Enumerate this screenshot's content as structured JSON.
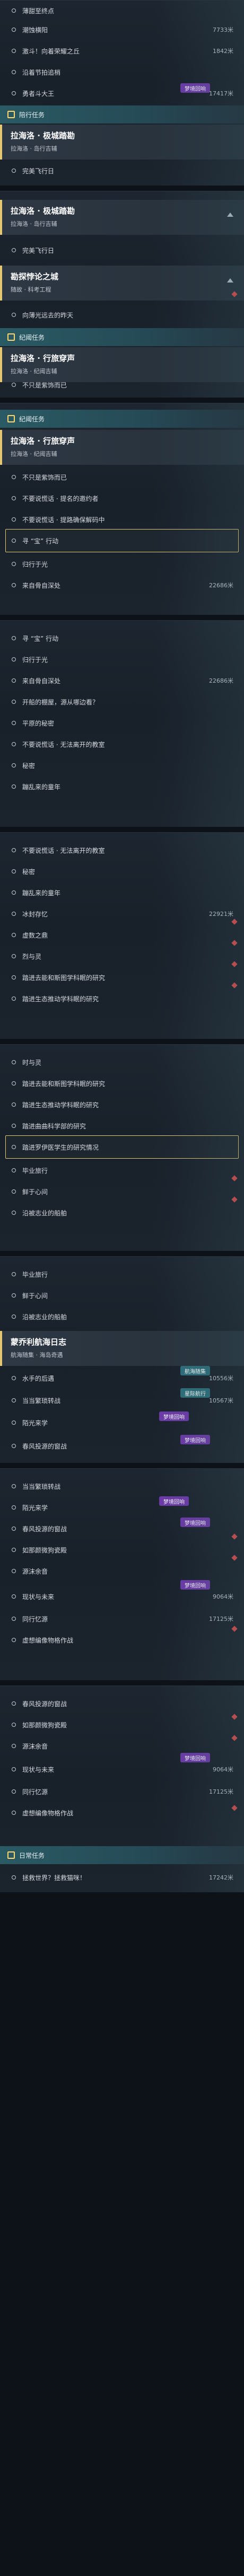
{
  "labels": {
    "silver_wolf_quest": "拉海洛 · 极城踏勘",
    "jarilo_area": "拉海洛 · 岛行吉辅",
    "sparkle": "拉海洛 · 行旅穿声",
    "sparkle_area": "拉海洛 · 纪阈吉辅",
    "caelum_quest": "蒙乔利航海日志",
    "caelum_area": "航海随集 · 海岛奇遇",
    "seminar": "勘探悖论之城",
    "seminar_area": "随故 · 科考工程"
  },
  "sections": {
    "companion": "陪行任务",
    "trailblaze_1": "纪阈任务",
    "trailblaze_2": "纪阈任务",
    "daily": "日常任务"
  },
  "tags": {
    "dream": "梦境回响",
    "hunt": "星际航行",
    "ship": "星际航行",
    "navi": "航海随集"
  },
  "items": {
    "a1": "薄甜至终点",
    "a2": "潮蚀横阳",
    "a3": "激斗！向着荣耀之丘",
    "a4": "沿着节拍追梢",
    "a5": "勇者斗大王",
    "b1": "完美飞行日",
    "c1": "完美飞行日",
    "d1": "向薄光远去的昨天",
    "e1": "不只是紫饰而已",
    "f1": "不只是紫饰而已",
    "f2": "不要说慌话 · 提名的邀约者",
    "f3": "不要说慌话 · 提路确保解码中",
    "f4": "寻 “宝” 行动",
    "f5": "归行于光",
    "f6": "来自骨自深处",
    "g1": "寻 “宝” 行动",
    "g2": "归行于光",
    "g3": "来自骨自深处",
    "g4": "开船的棚屋，源从哪边看？",
    "g5": "平原的秘密",
    "g6": "不要说慌话 · 无法离开的教室",
    "g7": "秘密",
    "g8": "蹦乱来的童年",
    "h1": "不要说慌话 · 无法离开的教室",
    "h2": "秘密",
    "h3": "蹦乱来的童年",
    "h4": "冰封存忆",
    "h5": "虚数之鼎",
    "h6": "烈与灵",
    "h7": "踏进去能和斯图学科眠的研究",
    "h8": "踏进生态推动学科眠的研究",
    "i1": "时与灵",
    "i2": "踏进去能和斯图学科眠的研究",
    "i3": "踏进生态推动学科眠的研究",
    "i4": "踏进曲曲科学部的研究",
    "i5": "踏进罗伊医学生的研究情况",
    "i6": "毕业旅行",
    "i7": "鲜于心间",
    "i8": "沿被志业的船舶",
    "j1": "毕业旅行",
    "j2": "鲜于心间",
    "j3": "沿被志业的船舶",
    "k1": "水手的后遇",
    "k2": "当当繁琐转战",
    "k3": "陌光来学",
    "k4": "春风投源的窗战",
    "l1": "当当繁琐转战",
    "l2": "陌光来学",
    "l3": "春风投源的窗战",
    "l4": "如那颜微狗瓷殿",
    "l5": "源沫余音",
    "l6": "现状与未来",
    "l7": "同行忆源",
    "l8": "虚想编像物格作战",
    "m1": "春风投源的窗战",
    "m2": "如那颜微狗瓷殿",
    "m3": "源沫余音",
    "m4": "现状与未来",
    "m5": "同行忆源",
    "m6": "虚想编像物格作战",
    "n1": "拯救世界？拯救猫咪！"
  },
  "distances": {
    "a2": "7733米",
    "a3": "1842米",
    "a5": "17417米",
    "f6": "22686米",
    "g3": "22686米",
    "h4": "22921米",
    "k1": "10556米",
    "k2": "10567米",
    "l6": "9064米",
    "l7": "17125米",
    "m4": "9064米",
    "m5": "17125米",
    "n1": "17242米"
  },
  "colors": {
    "accent_gold": "#e7c872",
    "section_teal": "#2a5a64",
    "tag_purple": "#6c3aa8",
    "marker_red": "#d84a4a"
  }
}
